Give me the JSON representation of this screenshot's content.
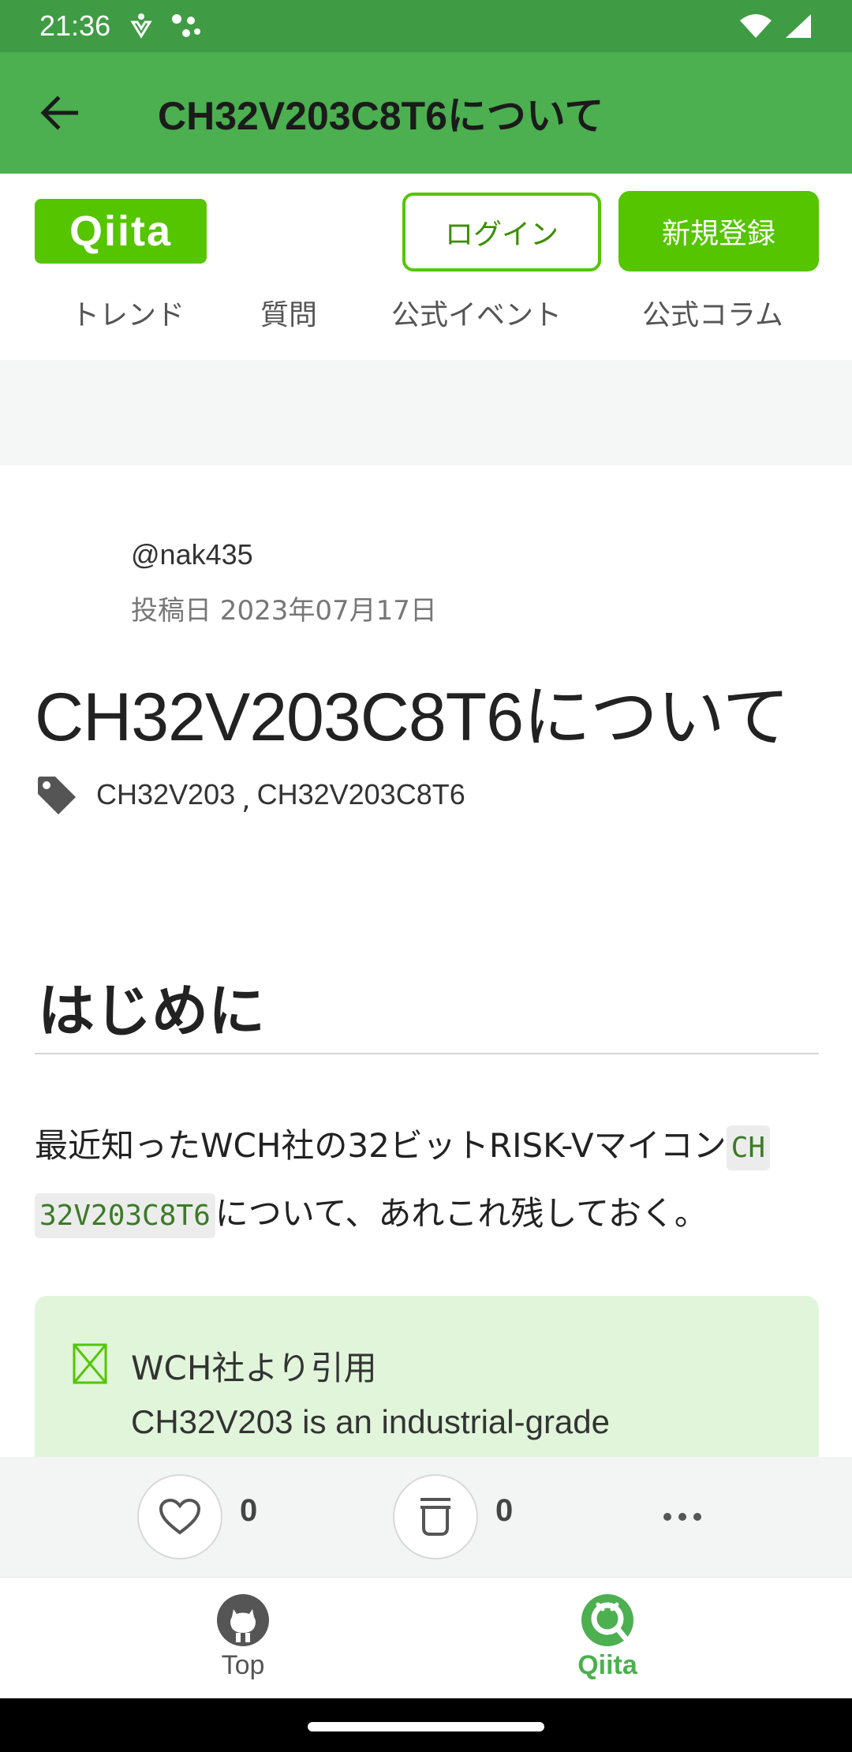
{
  "status_bar": {
    "time": "21:36"
  },
  "app_bar": {
    "title": "CH32V203C8T6について"
  },
  "header": {
    "logo": "Qiita",
    "login_label": "ログイン",
    "signup_label": "新規登録",
    "nav_tabs": [
      "トレンド",
      "質問",
      "公式イベント",
      "公式コラム"
    ]
  },
  "article": {
    "author": "@nak435",
    "posted_date": "投稿日 2023年07月17日",
    "title": "CH32V203C8T6について",
    "tags": [
      "CH32V203",
      "CH32V203C8T6"
    ],
    "tag_separator": ",",
    "section_heading": "はじめに",
    "para_line1_text": "最近知ったWCH社の32ビットRISK-Vマイコン",
    "para_code_part1": "CH",
    "para_code_part2": "32V203C8T6",
    "para_line2_text": "について、あれこれ残しておく。",
    "quote": {
      "title": "WCH社より引用",
      "text": "CH32V203 is an industrial-grade"
    }
  },
  "actions": {
    "like_count": "0",
    "stock_count": "0"
  },
  "bottom_nav": {
    "items": [
      {
        "label": "Top",
        "active": false
      },
      {
        "label": "Qiita",
        "active": true
      }
    ]
  },
  "colors": {
    "status_bar": "#3f9c44",
    "app_bar": "#4caf50",
    "qiita_green": "#55c500",
    "active_nav": "#4caf50",
    "inactive_nav": "#555555"
  }
}
